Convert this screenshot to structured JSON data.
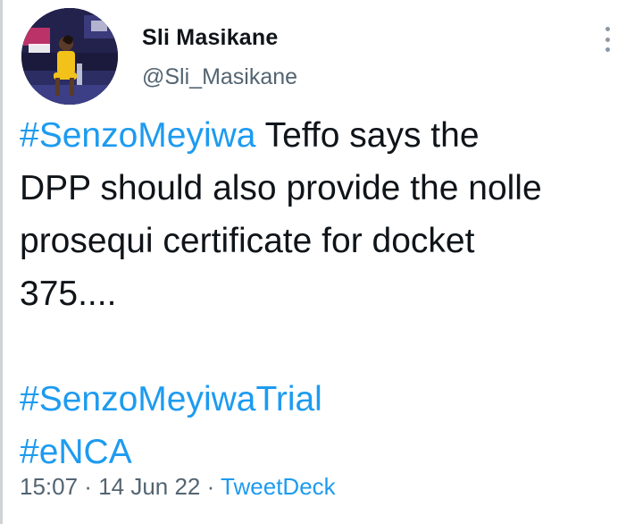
{
  "tweet": {
    "author": {
      "name": "Sli Masikane",
      "handle": "@Sli_Masikane"
    },
    "more_icon": "vertical-ellipsis-icon",
    "body": {
      "line1_hashtag": "#SenzoMeyiwa",
      "line1_text": " Teffo says the",
      "line2": "DPP should also provide the nolle",
      "line3": "prosequi certificate for docket",
      "line4": "375....",
      "hashtag_trial": "#SenzoMeyiwaTrial",
      "hashtag_enca": "#eNCA"
    },
    "meta": {
      "time": "15:07",
      "separator": " · ",
      "date": "14 Jun 22",
      "source": "TweetDeck"
    },
    "colors": {
      "link": "#1d9bf0",
      "secondary_text": "#536471",
      "primary_text": "#0f1419"
    }
  }
}
